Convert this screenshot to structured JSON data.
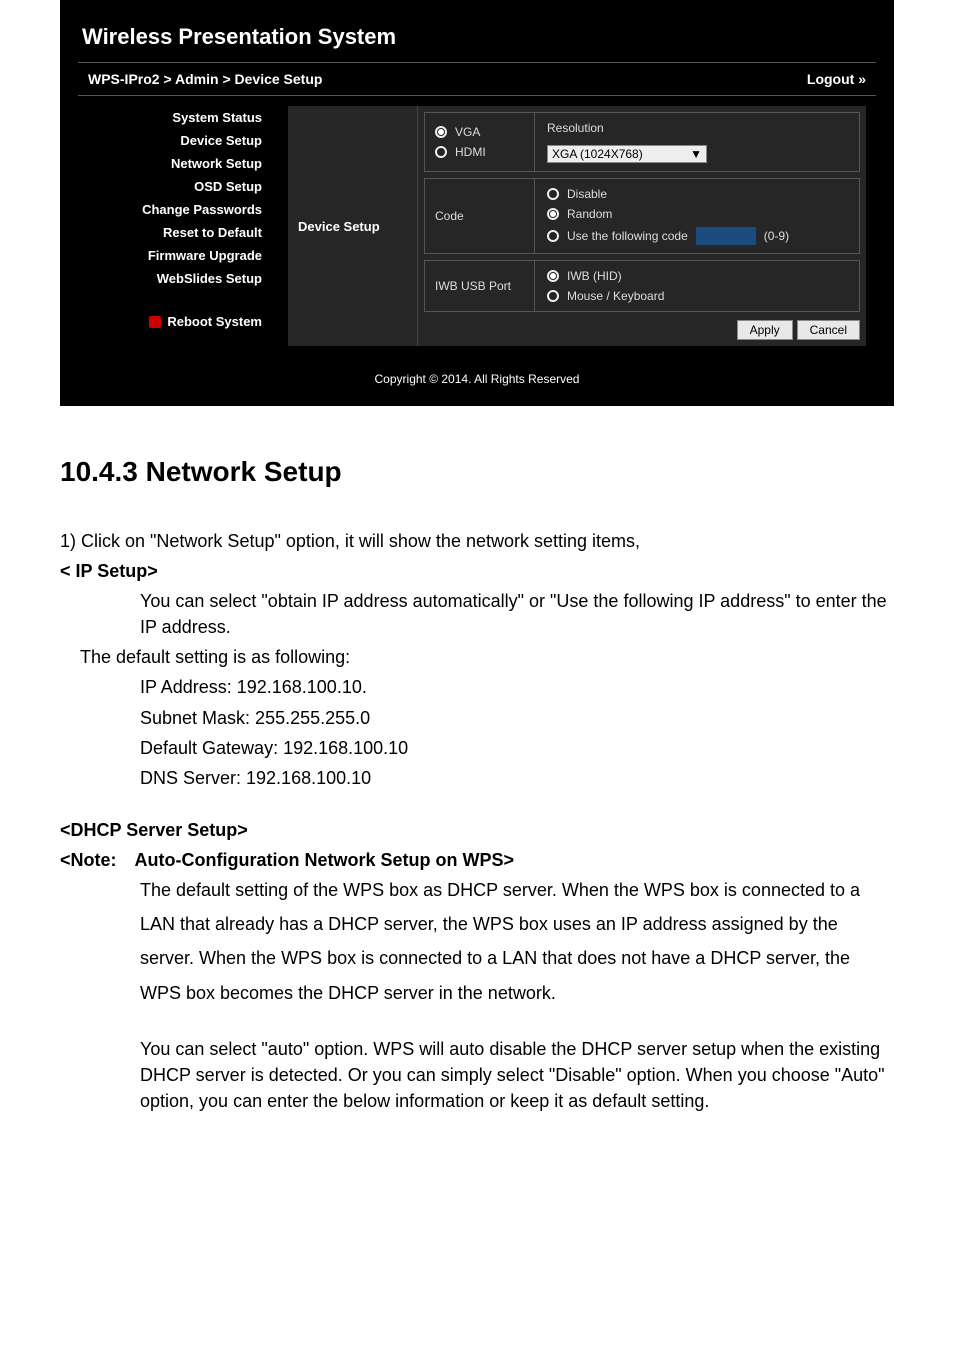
{
  "screenshot": {
    "system_title": "Wireless Presentation System",
    "breadcrumb": "WPS-IPro2 > Admin > Device Setup",
    "logout": "Logout »",
    "sidebar": {
      "items": [
        "System Status",
        "Device Setup",
        "Network Setup",
        "OSD Setup",
        "Change Passwords",
        "Reset to Default",
        "Firmware Upgrade",
        "WebSlides Setup"
      ],
      "reboot": "Reboot System"
    },
    "panel_label": "Device Setup",
    "outputs": {
      "vga": "VGA",
      "hdmi": "HDMI",
      "resolution_label": "Resolution",
      "resolution_value": "XGA (1024X768)"
    },
    "code": {
      "label": "Code",
      "disable": "Disable",
      "random": "Random",
      "use_following": "Use the following code",
      "code_range": "(0-9)"
    },
    "iwb": {
      "label": "IWB USB Port",
      "iwb_hid": "IWB (HID)",
      "mouse_kb": "Mouse / Keyboard"
    },
    "buttons": {
      "apply": "Apply",
      "cancel": "Cancel"
    },
    "copyright": "Copyright © 2014. All Rights Reserved"
  },
  "doc": {
    "heading": "10.4.3  Network Setup",
    "line1": "1)   Click on \"Network Setup\" option, it will show the network setting items,",
    "ip_setup_label": "< IP Setup>",
    "ip_setup_desc1": "You can select \"obtain IP address automatically\" or \"Use the following IP address\" to enter the IP address.",
    "default_setting_intro": "The default setting is as following:",
    "ip_address": "IP Address: 192.168.100.10.",
    "subnet": "Subnet Mask: 255.255.255.0",
    "gateway": "Default Gateway: 192.168.100.10",
    "dns": "DNS Server: 192.168.100.10",
    "dhcp_label": "<DHCP Server Setup>",
    "note_prefix": "<Note:",
    "note_title": "Auto-Configuration Network Setup on WPS>",
    "note_body": "The default setting of the WPS box as DHCP server. When the WPS box is connected to a LAN that already has a DHCP server, the WPS box uses an IP address assigned by the server. When the WPS box is connected to a LAN that does not have a DHCP server, the WPS box becomes the DHCP server in the network.",
    "para2": "You can select \"auto\" option. WPS will auto disable the DHCP server setup when the existing DHCP server is detected. Or you can simply select \"Disable\" option. When you choose \"Auto\" option, you can enter the below information or keep it as default setting."
  }
}
